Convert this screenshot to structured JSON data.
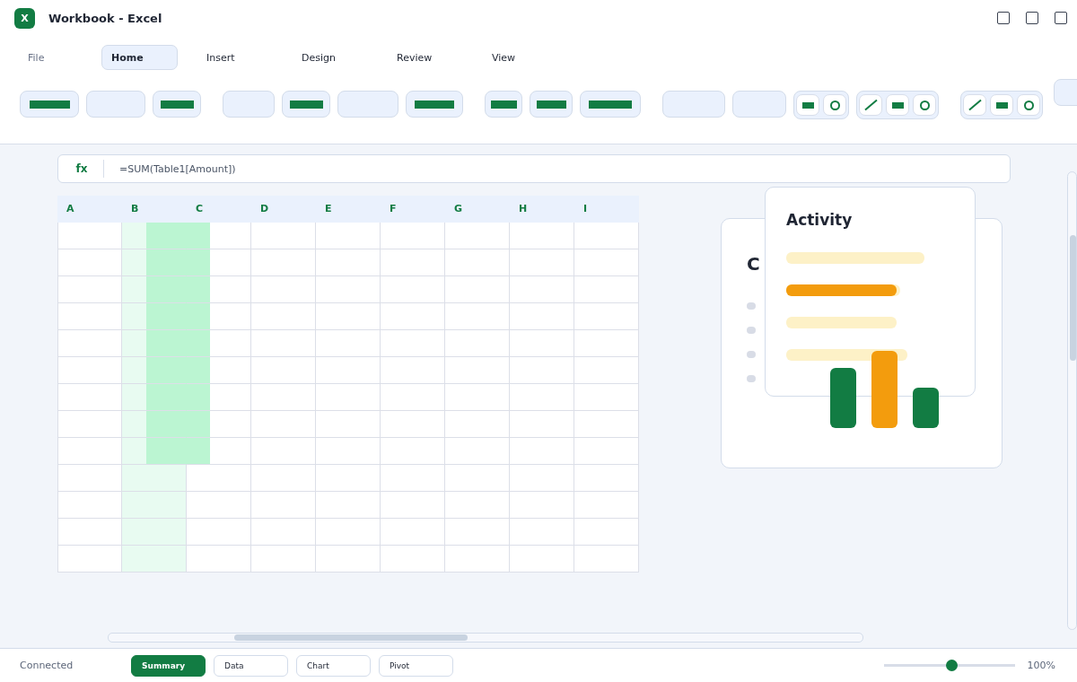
{
  "window": {
    "title": "Workbook - Excel",
    "app_letter": "X"
  },
  "tabs": [
    {
      "label": "File",
      "selected": false
    },
    {
      "label": "Home",
      "selected": true
    },
    {
      "label": "Insert",
      "selected": false
    },
    {
      "label": "Design",
      "selected": false
    },
    {
      "label": "Review",
      "selected": false
    },
    {
      "label": "View",
      "selected": false
    }
  ],
  "formula_bar": {
    "label": "fx",
    "value": "=SUM(Table1[Amount])"
  },
  "grid": {
    "columns": [
      {
        "label": "A",
        "selected": false
      },
      {
        "label": "B",
        "selected": true
      },
      {
        "label": "C",
        "selected": false
      },
      {
        "label": "D",
        "selected": false
      },
      {
        "label": "E",
        "selected": false
      },
      {
        "label": "F",
        "selected": false
      },
      {
        "label": "G",
        "selected": false
      },
      {
        "label": "H",
        "selected": false
      },
      {
        "label": "I",
        "selected": false
      }
    ],
    "rows": [
      {
        "selected": true
      },
      {
        "selected": true
      },
      {
        "selected": true
      },
      {
        "selected": true
      },
      {
        "selected": true
      },
      {
        "selected": true
      },
      {
        "selected": true
      },
      {
        "selected": true
      },
      {
        "selected": true
      },
      {
        "selected": false
      },
      {
        "selected": false
      },
      {
        "selected": false
      },
      {
        "selected": false
      }
    ]
  },
  "back_card": {
    "title": "C"
  },
  "activity_card": {
    "title": "Activity"
  },
  "status_bar": {
    "status": "Connected",
    "zoom": {
      "level": 0.52,
      "reading": "100%"
    }
  },
  "sheets": [
    {
      "label": "Summary",
      "selected": true
    },
    {
      "label": "Data",
      "selected": false
    },
    {
      "label": "Chart",
      "selected": false
    },
    {
      "label": "Pivot",
      "selected": false
    }
  ]
}
